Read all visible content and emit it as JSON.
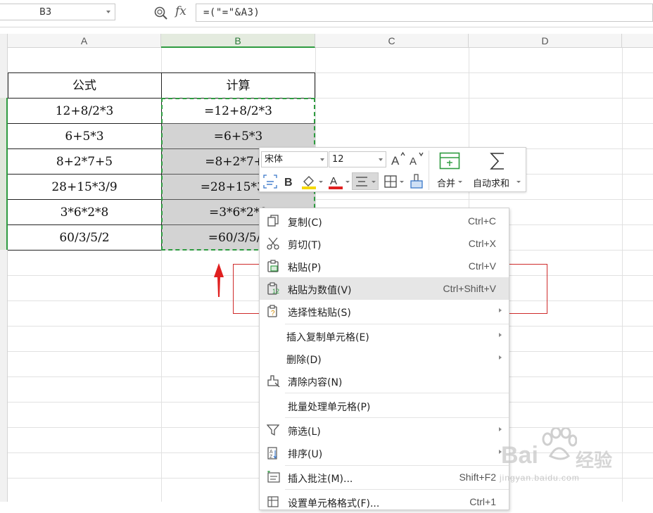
{
  "formula_bar": {
    "cell_ref": "B3",
    "fx_label": "fx",
    "formula": "=(\"=\"&A3)"
  },
  "columns": [
    "A",
    "B",
    "C",
    "D"
  ],
  "table": {
    "headers": [
      "公式",
      "计算"
    ],
    "rows": [
      {
        "a": "12+8/2*3",
        "b": "=12+8/2*3"
      },
      {
        "a": "6+5*3",
        "b": "=6+5*3"
      },
      {
        "a": "8+2*7+5",
        "b": "=8+2*7+5"
      },
      {
        "a": "28+15*3/9",
        "b": "=28+15*3/9"
      },
      {
        "a": "3*6*2*8",
        "b": "=3*6*2*8"
      },
      {
        "a": "60/3/5/2",
        "b": "=60/3/5/2"
      }
    ]
  },
  "mini_toolbar": {
    "font_name": "宋体",
    "font_size": "12",
    "merge_label": "合并",
    "autosum_label": "自动求和"
  },
  "context_menu": {
    "items": [
      {
        "label": "复制(C)",
        "shortcut": "Ctrl+C"
      },
      {
        "label": "剪切(T)",
        "shortcut": "Ctrl+X"
      },
      {
        "label": "粘贴(P)",
        "shortcut": "Ctrl+V"
      },
      {
        "label": "粘贴为数值(V)",
        "shortcut": "Ctrl+Shift+V"
      },
      {
        "label": "选择性粘贴(S)",
        "shortcut": ""
      },
      {
        "label": "插入复制单元格(E)",
        "shortcut": ""
      },
      {
        "label": "删除(D)",
        "shortcut": ""
      },
      {
        "label": "清除内容(N)",
        "shortcut": ""
      },
      {
        "label": "批量处理单元格(P)",
        "shortcut": ""
      },
      {
        "label": "筛选(L)",
        "shortcut": ""
      },
      {
        "label": "排序(U)",
        "shortcut": ""
      },
      {
        "label": "插入批注(M)...",
        "shortcut": "Shift+F2"
      },
      {
        "label": "设置单元格格式(F)...",
        "shortcut": "Ctrl+1"
      }
    ]
  },
  "watermark": {
    "brand": "Bai",
    "brand_cn": "经验",
    "url": "jingyan.baidu.com"
  },
  "colors": {
    "selection_green": "#2d9b3f",
    "annotation_red": "#cf2b2b",
    "selected_fill": "#d3d3d3"
  }
}
